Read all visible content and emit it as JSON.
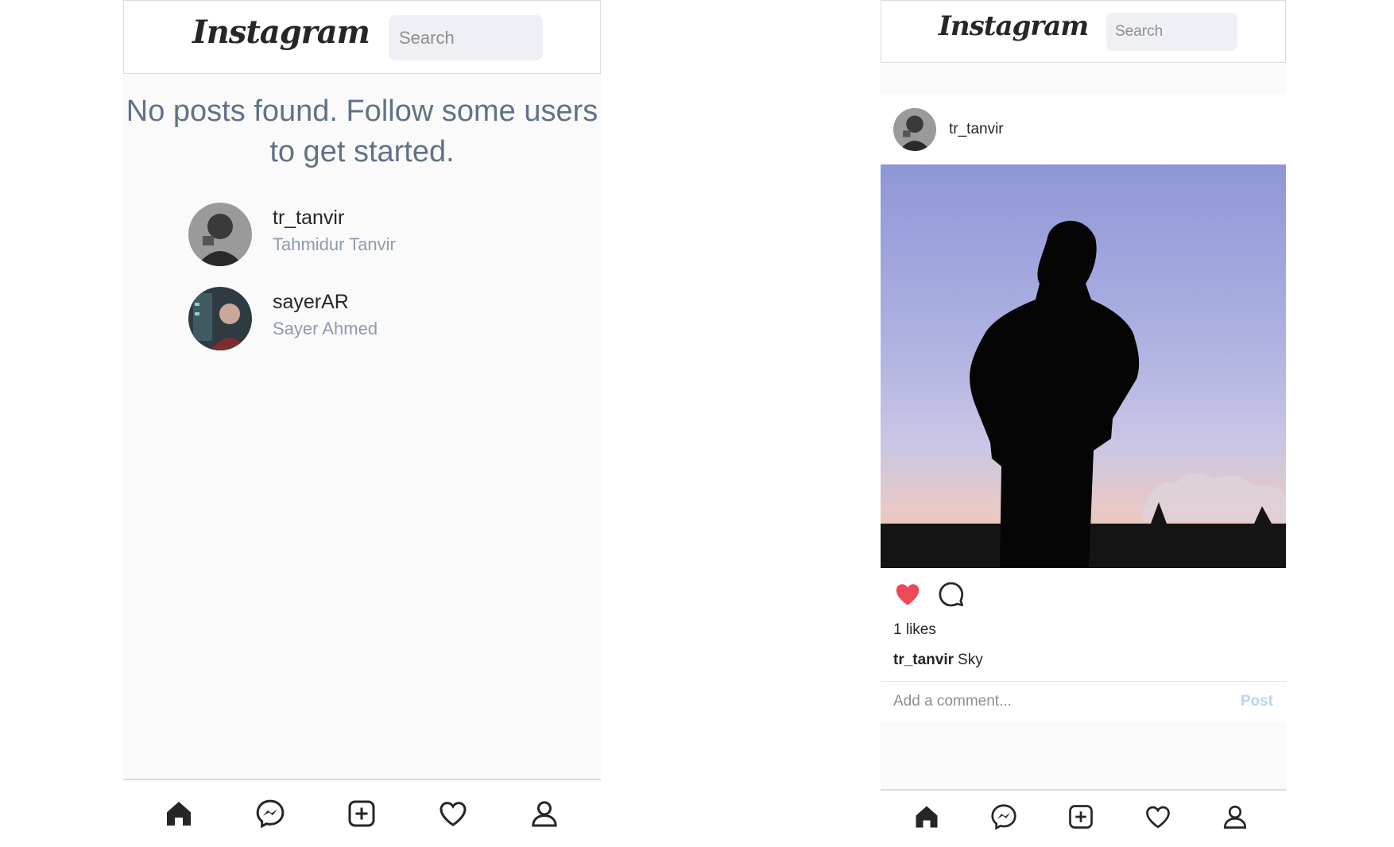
{
  "left_screen": {
    "header": {
      "logo_text": "Instagram",
      "search_placeholder": "Search"
    },
    "empty_message": "No posts found. Follow some users to get started.",
    "suggestions": [
      {
        "username": "tr_tanvir",
        "full_name": "Tahmidur Tanvir"
      },
      {
        "username": "sayerAR",
        "full_name": "Sayer Ahmed"
      }
    ],
    "nav": [
      "home-icon",
      "messenger-icon",
      "add-post-icon",
      "heart-icon",
      "profile-icon"
    ]
  },
  "right_screen": {
    "header": {
      "logo_text": "Instagram",
      "search_placeholder": "Search"
    },
    "post": {
      "username": "tr_tanvir",
      "likes_text": "1 likes",
      "caption_user": "tr_tanvir",
      "caption_text": "Sky",
      "liked": true,
      "comment_placeholder": "Add a comment...",
      "post_button": "Post"
    },
    "nav": [
      "home-icon",
      "messenger-icon",
      "add-post-icon",
      "heart-icon",
      "profile-icon"
    ]
  },
  "colors": {
    "like_red": "#ed4956",
    "post_button_disabled": "#b3d6f7",
    "muted_text": "#8e9aaf"
  }
}
